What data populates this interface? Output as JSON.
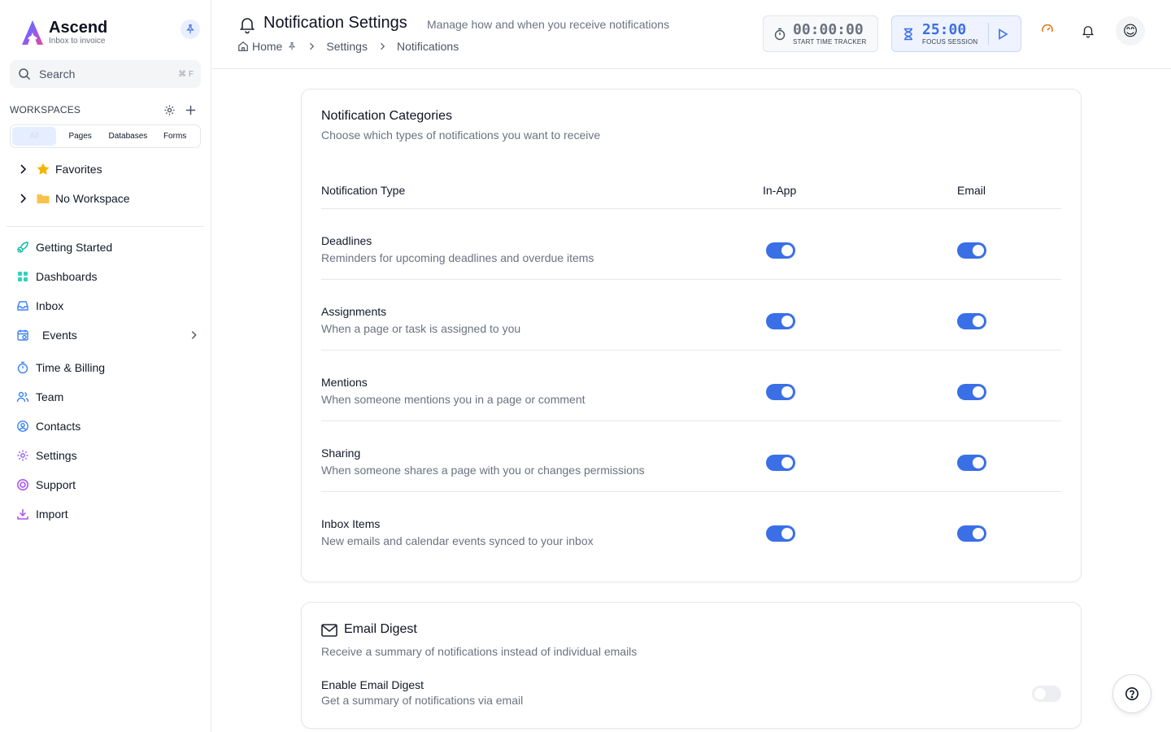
{
  "brand": {
    "name": "Ascend",
    "tagline": "Inbox to invoice",
    "colors": {
      "primary": "#3b6fe6",
      "accent": "#7c5cff"
    }
  },
  "sidebar": {
    "search": {
      "placeholder": "Search",
      "shortcut": "⌘ F"
    },
    "workspaces_label": "WORKSPACES",
    "segments": [
      "All",
      "Pages",
      "Databases",
      "Forms"
    ],
    "tree": [
      {
        "label": "Favorites",
        "icon": "star-icon"
      },
      {
        "label": "No Workspace",
        "icon": "folder-icon"
      }
    ],
    "nav": [
      {
        "label": "Getting Started",
        "icon": "rocket-icon"
      },
      {
        "label": "Dashboards",
        "icon": "dashboard-icon"
      },
      {
        "label": "Inbox",
        "icon": "inbox-icon"
      },
      {
        "label": "Events",
        "icon": "calendar-icon"
      },
      {
        "label": "Time & Billing",
        "icon": "stopwatch-icon"
      },
      {
        "label": "Team",
        "icon": "users-icon"
      },
      {
        "label": "Contacts",
        "icon": "contact-icon"
      },
      {
        "label": "Settings",
        "icon": "gear-icon"
      },
      {
        "label": "Support",
        "icon": "lifebuoy-icon"
      },
      {
        "label": "Import",
        "icon": "download-icon"
      }
    ]
  },
  "header": {
    "title": "Notification Settings",
    "subtitle": "Manage how and when you receive notifications",
    "breadcrumbs": [
      "Home",
      "Settings",
      "Notifications"
    ],
    "time_tracker": {
      "value": "00:00:00",
      "caption": "START TIME TRACKER"
    },
    "focus_session": {
      "value": "25:00",
      "caption": "FOCUS SESSION"
    },
    "avatar": "😊"
  },
  "categories": {
    "title": "Notification Categories",
    "description": "Choose which types of notifications you want to receive",
    "columns": [
      "Notification Type",
      "In-App",
      "Email"
    ],
    "rows": [
      {
        "name": "Deadlines",
        "description": "Reminders for upcoming deadlines and overdue items",
        "in_app": true,
        "email": true
      },
      {
        "name": "Assignments",
        "description": "When a page or task is assigned to you",
        "in_app": true,
        "email": true
      },
      {
        "name": "Mentions",
        "description": "When someone mentions you in a page or comment",
        "in_app": true,
        "email": true
      },
      {
        "name": "Sharing",
        "description": "When someone shares a page with you or changes permissions",
        "in_app": true,
        "email": true
      },
      {
        "name": "Inbox Items",
        "description": "New emails and calendar events synced to your inbox",
        "in_app": true,
        "email": true
      }
    ]
  },
  "digest": {
    "title": "Email Digest",
    "description": "Receive a summary of notifications instead of individual emails",
    "option_label": "Enable Email Digest",
    "option_description": "Get a summary of notifications via email",
    "enabled": false
  }
}
